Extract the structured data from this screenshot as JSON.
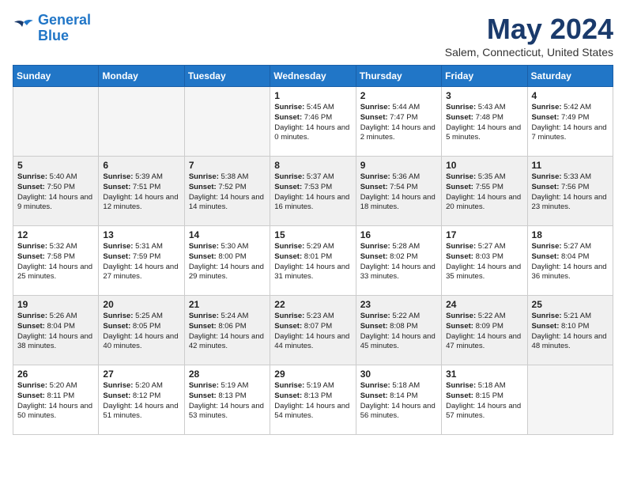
{
  "header": {
    "logo_line1": "General",
    "logo_line2": "Blue",
    "month_title": "May 2024",
    "location": "Salem, Connecticut, United States"
  },
  "days_of_week": [
    "Sunday",
    "Monday",
    "Tuesday",
    "Wednesday",
    "Thursday",
    "Friday",
    "Saturday"
  ],
  "weeks": [
    [
      {
        "day": "",
        "empty": true
      },
      {
        "day": "",
        "empty": true
      },
      {
        "day": "",
        "empty": true
      },
      {
        "day": "1",
        "sunrise": "5:45 AM",
        "sunset": "7:46 PM",
        "daylight": "14 hours and 0 minutes."
      },
      {
        "day": "2",
        "sunrise": "5:44 AM",
        "sunset": "7:47 PM",
        "daylight": "14 hours and 2 minutes."
      },
      {
        "day": "3",
        "sunrise": "5:43 AM",
        "sunset": "7:48 PM",
        "daylight": "14 hours and 5 minutes."
      },
      {
        "day": "4",
        "sunrise": "5:42 AM",
        "sunset": "7:49 PM",
        "daylight": "14 hours and 7 minutes."
      }
    ],
    [
      {
        "day": "5",
        "sunrise": "5:40 AM",
        "sunset": "7:50 PM",
        "daylight": "14 hours and 9 minutes."
      },
      {
        "day": "6",
        "sunrise": "5:39 AM",
        "sunset": "7:51 PM",
        "daylight": "14 hours and 12 minutes."
      },
      {
        "day": "7",
        "sunrise": "5:38 AM",
        "sunset": "7:52 PM",
        "daylight": "14 hours and 14 minutes."
      },
      {
        "day": "8",
        "sunrise": "5:37 AM",
        "sunset": "7:53 PM",
        "daylight": "14 hours and 16 minutes."
      },
      {
        "day": "9",
        "sunrise": "5:36 AM",
        "sunset": "7:54 PM",
        "daylight": "14 hours and 18 minutes."
      },
      {
        "day": "10",
        "sunrise": "5:35 AM",
        "sunset": "7:55 PM",
        "daylight": "14 hours and 20 minutes."
      },
      {
        "day": "11",
        "sunrise": "5:33 AM",
        "sunset": "7:56 PM",
        "daylight": "14 hours and 23 minutes."
      }
    ],
    [
      {
        "day": "12",
        "sunrise": "5:32 AM",
        "sunset": "7:58 PM",
        "daylight": "14 hours and 25 minutes."
      },
      {
        "day": "13",
        "sunrise": "5:31 AM",
        "sunset": "7:59 PM",
        "daylight": "14 hours and 27 minutes."
      },
      {
        "day": "14",
        "sunrise": "5:30 AM",
        "sunset": "8:00 PM",
        "daylight": "14 hours and 29 minutes."
      },
      {
        "day": "15",
        "sunrise": "5:29 AM",
        "sunset": "8:01 PM",
        "daylight": "14 hours and 31 minutes."
      },
      {
        "day": "16",
        "sunrise": "5:28 AM",
        "sunset": "8:02 PM",
        "daylight": "14 hours and 33 minutes."
      },
      {
        "day": "17",
        "sunrise": "5:27 AM",
        "sunset": "8:03 PM",
        "daylight": "14 hours and 35 minutes."
      },
      {
        "day": "18",
        "sunrise": "5:27 AM",
        "sunset": "8:04 PM",
        "daylight": "14 hours and 36 minutes."
      }
    ],
    [
      {
        "day": "19",
        "sunrise": "5:26 AM",
        "sunset": "8:04 PM",
        "daylight": "14 hours and 38 minutes."
      },
      {
        "day": "20",
        "sunrise": "5:25 AM",
        "sunset": "8:05 PM",
        "daylight": "14 hours and 40 minutes."
      },
      {
        "day": "21",
        "sunrise": "5:24 AM",
        "sunset": "8:06 PM",
        "daylight": "14 hours and 42 minutes."
      },
      {
        "day": "22",
        "sunrise": "5:23 AM",
        "sunset": "8:07 PM",
        "daylight": "14 hours and 44 minutes."
      },
      {
        "day": "23",
        "sunrise": "5:22 AM",
        "sunset": "8:08 PM",
        "daylight": "14 hours and 45 minutes."
      },
      {
        "day": "24",
        "sunrise": "5:22 AM",
        "sunset": "8:09 PM",
        "daylight": "14 hours and 47 minutes."
      },
      {
        "day": "25",
        "sunrise": "5:21 AM",
        "sunset": "8:10 PM",
        "daylight": "14 hours and 48 minutes."
      }
    ],
    [
      {
        "day": "26",
        "sunrise": "5:20 AM",
        "sunset": "8:11 PM",
        "daylight": "14 hours and 50 minutes."
      },
      {
        "day": "27",
        "sunrise": "5:20 AM",
        "sunset": "8:12 PM",
        "daylight": "14 hours and 51 minutes."
      },
      {
        "day": "28",
        "sunrise": "5:19 AM",
        "sunset": "8:13 PM",
        "daylight": "14 hours and 53 minutes."
      },
      {
        "day": "29",
        "sunrise": "5:19 AM",
        "sunset": "8:13 PM",
        "daylight": "14 hours and 54 minutes."
      },
      {
        "day": "30",
        "sunrise": "5:18 AM",
        "sunset": "8:14 PM",
        "daylight": "14 hours and 56 minutes."
      },
      {
        "day": "31",
        "sunrise": "5:18 AM",
        "sunset": "8:15 PM",
        "daylight": "14 hours and 57 minutes."
      },
      {
        "day": "",
        "empty": true
      }
    ]
  ],
  "labels": {
    "sunrise": "Sunrise:",
    "sunset": "Sunset:",
    "daylight": "Daylight:"
  },
  "colors": {
    "header_bg": "#2176c7",
    "header_text": "#fff",
    "title_color": "#1a3a6b",
    "shaded_row": "#f0f0f0"
  }
}
